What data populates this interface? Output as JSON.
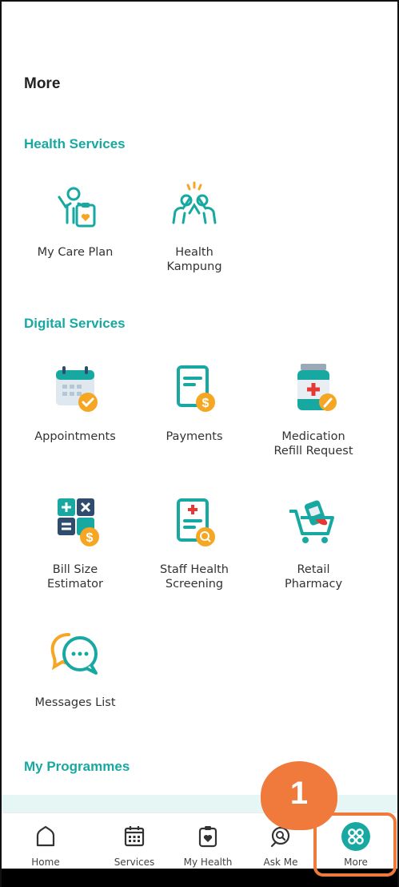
{
  "page": {
    "title": "More"
  },
  "sections": {
    "health": {
      "title": "Health Services"
    },
    "digital": {
      "title": "Digital Services"
    },
    "programmes": {
      "title": "My Programmes"
    }
  },
  "tiles": {
    "my_care_plan": {
      "label": "My Care Plan",
      "icon": "care-plan-icon"
    },
    "health_kampung": {
      "label": "Health\nKampung",
      "icon": "community-icon"
    },
    "appointments": {
      "label": "Appointments",
      "icon": "calendar-check-icon"
    },
    "payments": {
      "label": "Payments",
      "icon": "invoice-dollar-icon"
    },
    "medication_refill": {
      "label": "Medication\nRefill Request",
      "icon": "medicine-bottle-icon"
    },
    "bill_size": {
      "label": "Bill Size\nEstimator",
      "icon": "calculator-icon"
    },
    "staff_health": {
      "label": "Staff Health\nScreening",
      "icon": "clipboard-search-icon"
    },
    "retail_pharmacy": {
      "label": "Retail\nPharmacy",
      "icon": "shopping-cart-icon"
    },
    "messages_list": {
      "label": "Messages List",
      "icon": "chat-bubbles-icon"
    }
  },
  "nav": {
    "home": {
      "label": "Home",
      "icon": "home-icon"
    },
    "services": {
      "label": "Services",
      "icon": "calendar-icon"
    },
    "my_health": {
      "label": "My Health",
      "icon": "health-record-icon"
    },
    "ask_me": {
      "label": "Ask Me",
      "icon": "search-chat-icon"
    },
    "more": {
      "label": "More",
      "icon": "grid-icon"
    }
  },
  "annotation": {
    "step": "1"
  },
  "colors": {
    "teal": "#17a9a1",
    "orange": "#f5a623",
    "red": "#e53935",
    "navy": "#2f4b6e",
    "highlight": "#ef7a3c"
  }
}
